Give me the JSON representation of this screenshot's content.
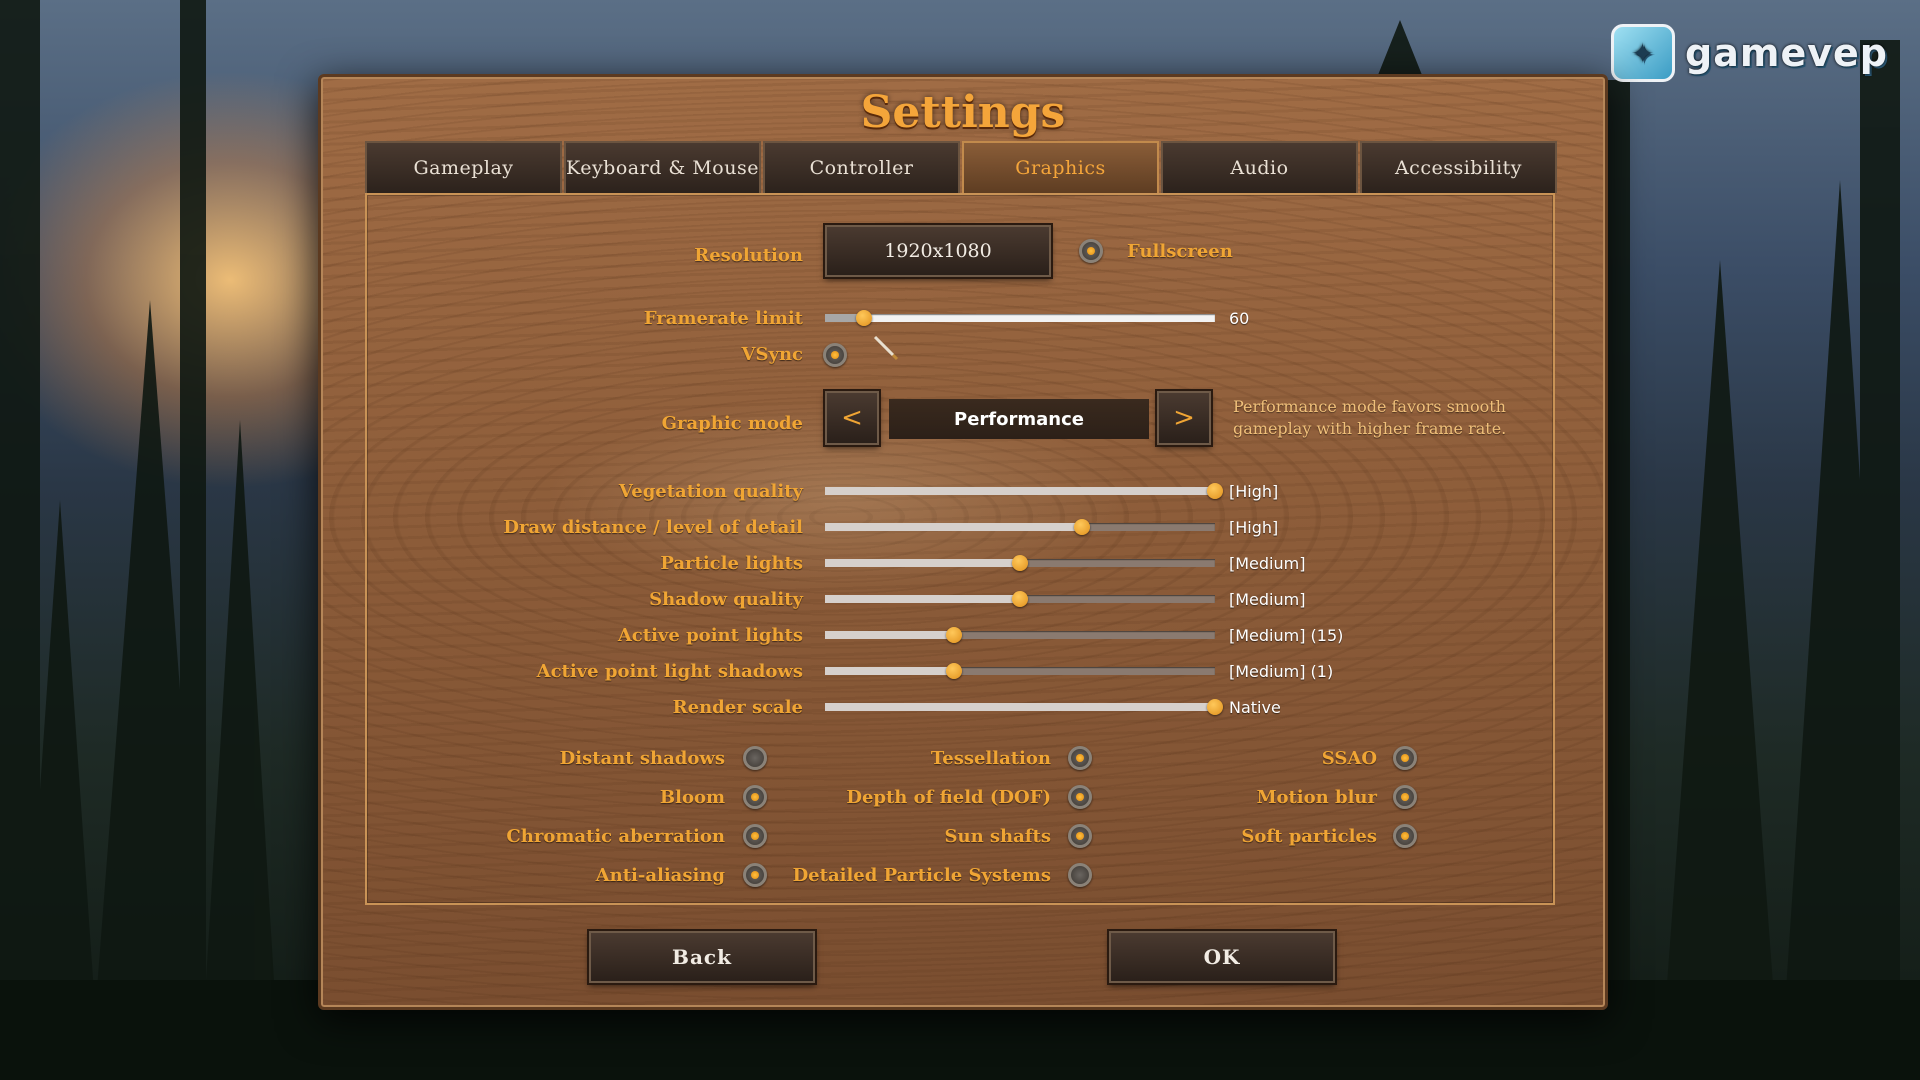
{
  "watermark": {
    "text": "gamevep"
  },
  "window": {
    "title": "Settings"
  },
  "tabs": [
    {
      "label": "Gameplay",
      "active": false
    },
    {
      "label": "Keyboard & Mouse",
      "active": false
    },
    {
      "label": "Controller",
      "active": false
    },
    {
      "label": "Graphics",
      "active": true
    },
    {
      "label": "Audio",
      "active": false
    },
    {
      "label": "Accessibility",
      "active": false
    }
  ],
  "resolution": {
    "label": "Resolution",
    "value": "1920x1080"
  },
  "fullscreen": {
    "label": "Fullscreen",
    "checked": true
  },
  "framerate": {
    "label": "Framerate limit",
    "value": "60",
    "level": 0.1
  },
  "vsync": {
    "label": "VSync",
    "checked": true
  },
  "graphic_mode": {
    "label": "Graphic mode",
    "value": "Performance",
    "prev_icon": "chevron-left-icon",
    "next_icon": "chevron-right-icon",
    "description": "Performance mode favors smooth gameplay with higher frame rate."
  },
  "quality_sliders": [
    {
      "label": "Vegetation quality",
      "value": "[High]",
      "level": 1.0
    },
    {
      "label": "Draw distance / level of detail",
      "value": "[High]",
      "level": 0.66
    },
    {
      "label": "Particle lights",
      "value": "[Medium]",
      "level": 0.5
    },
    {
      "label": "Shadow quality",
      "value": "[Medium]",
      "level": 0.5
    },
    {
      "label": "Active point lights",
      "value": "[Medium] (15)",
      "level": 0.33
    },
    {
      "label": "Active point light shadows",
      "value": "[Medium] (1)",
      "level": 0.33
    },
    {
      "label": "Render scale",
      "value": "Native",
      "level": 1.0
    }
  ],
  "toggles": [
    {
      "label": "Distant shadows",
      "checked": false
    },
    {
      "label": "Tessellation",
      "checked": true
    },
    {
      "label": "SSAO",
      "checked": true
    },
    {
      "label": "Bloom",
      "checked": true
    },
    {
      "label": "Depth of field (DOF)",
      "checked": true
    },
    {
      "label": "Motion blur",
      "checked": true
    },
    {
      "label": "Chromatic aberration",
      "checked": true
    },
    {
      "label": "Sun shafts",
      "checked": true
    },
    {
      "label": "Soft particles",
      "checked": true
    },
    {
      "label": "Anti-aliasing",
      "checked": true
    },
    {
      "label": "Detailed Particle Systems",
      "checked": false
    }
  ],
  "buttons": {
    "back": "Back",
    "ok": "OK"
  },
  "colors": {
    "accent": "#f0a534",
    "panel": "#8c5c39",
    "knob": "#e0901c"
  }
}
